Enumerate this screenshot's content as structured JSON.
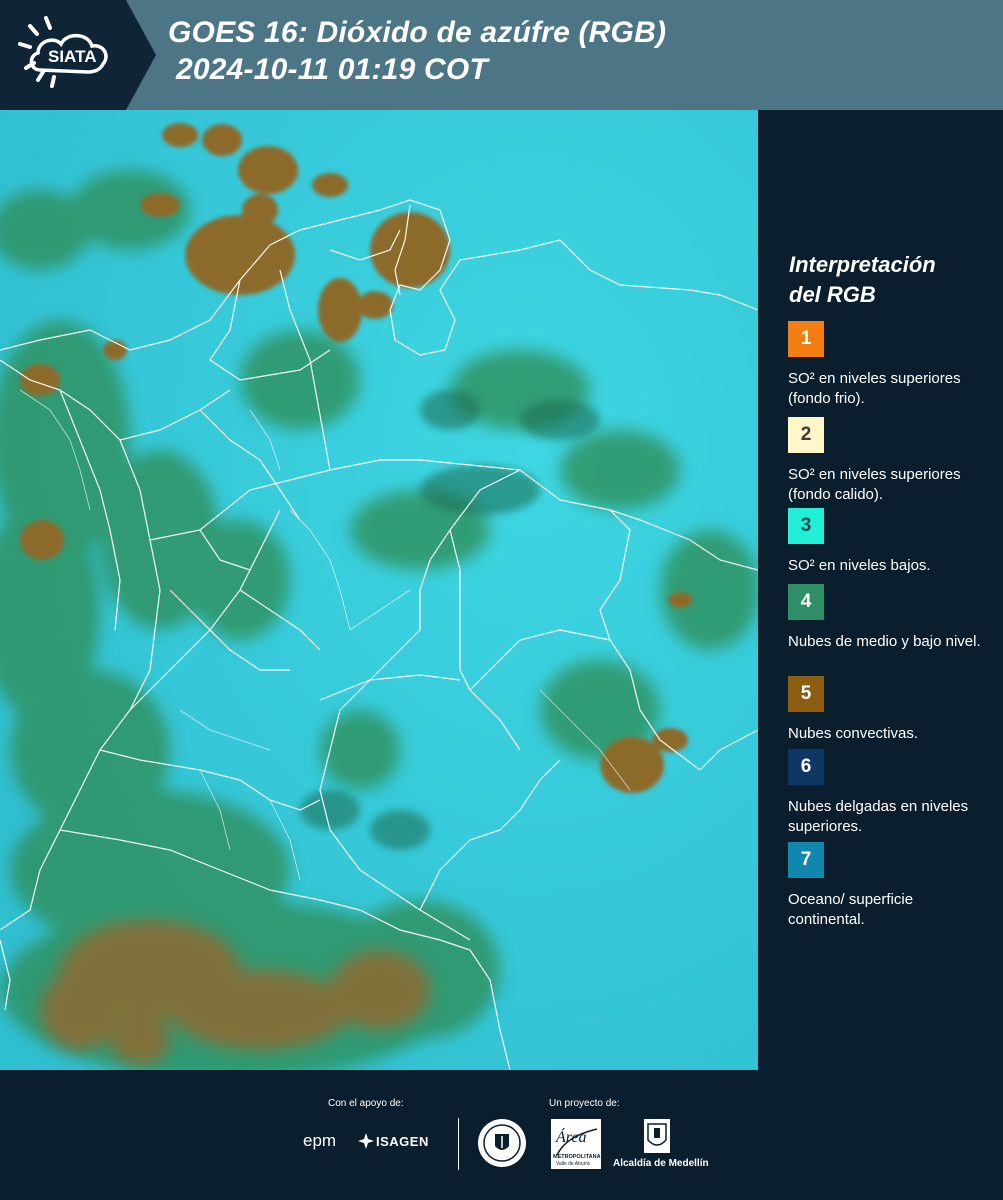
{
  "header": {
    "logo_text": "SIATA",
    "title_line1": "GOES 16: Dióxido de azúfre (RGB)",
    "title_line2": "2024-10-11 01:19 COT"
  },
  "legend": {
    "title_line1": "Interpretación",
    "title_line2": "del RGB",
    "items": [
      {
        "number": "1",
        "label": "SO² en niveles superiores (fondo frio).",
        "color": "#f47e12",
        "text_color": "#ffffff"
      },
      {
        "number": "2",
        "label": "SO² en niveles superiores (fondo calido).",
        "color": "#fff7c7",
        "text_color": "#3b3b3b"
      },
      {
        "number": "3",
        "label": "SO² en niveles bajos.",
        "color": "#22f0d6",
        "text_color": "#1d4a52"
      },
      {
        "number": "4",
        "label": "Nubes de medio y bajo nivel.",
        "color": "#2e8f66",
        "text_color": "#ffffff"
      },
      {
        "number": "5",
        "label": "Nubes convectivas.",
        "color": "#8c5c10",
        "text_color": "#ffffff"
      },
      {
        "number": "6",
        "label": "Nubes delgadas en niveles superiores.",
        "color": "#0e3764",
        "text_color": "#ffffff"
      },
      {
        "number": "7",
        "label": "Oceano/ superficie continental.",
        "color": "#1187ae",
        "text_color": "#ffffff"
      }
    ]
  },
  "footer": {
    "support_label": "Con el apoyo de:",
    "project_label": "Un proyecto de:",
    "sponsor_epm": "epm",
    "sponsor_isagen": "ISAGEN",
    "area_name": "Área",
    "area_sub1": "METROPOLITANA",
    "area_sub2": "Valle de Aburrá",
    "alcaldia": "Alcaldía de Medellín"
  },
  "colors": {
    "header_bg": "#4c7585",
    "panel_bg": "#0b1e2d",
    "map_background_cyan": "#35c9d8",
    "convective_brown": "#8c6a2c",
    "low_cloud_green": "#2f8a4a",
    "border_white": "#ffffff"
  },
  "icons": [
    "siata-logo-icon",
    "medellin-seal-icon",
    "area-metropolitana-logo-icon",
    "alcaldia-emblem-icon",
    "isagen-logo-icon"
  ]
}
